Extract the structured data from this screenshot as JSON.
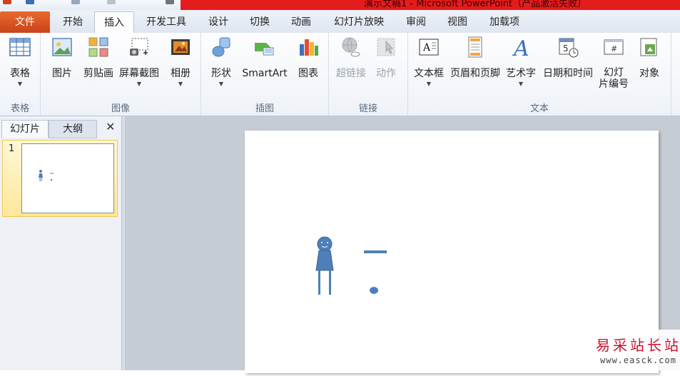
{
  "window": {
    "title": "演示文稿1 - Microsoft PowerPoint（产品激活失败）"
  },
  "tabs": {
    "file": "文件",
    "items": [
      {
        "label": "开始"
      },
      {
        "label": "插入"
      },
      {
        "label": "开发工具"
      },
      {
        "label": "设计"
      },
      {
        "label": "切换"
      },
      {
        "label": "动画"
      },
      {
        "label": "幻灯片放映"
      },
      {
        "label": "审阅"
      },
      {
        "label": "视图"
      },
      {
        "label": "加载项"
      }
    ],
    "active": "插入"
  },
  "ribbon": {
    "groups": {
      "tables": {
        "label": "表格",
        "buttons": {
          "table": "表格"
        }
      },
      "images": {
        "label": "图像",
        "buttons": {
          "picture": "图片",
          "clipart": "剪贴画",
          "screenshot": "屏幕截图",
          "album": "相册"
        }
      },
      "illustrations": {
        "label": "插图",
        "buttons": {
          "shapes": "形状",
          "smartart": "SmartArt",
          "chart": "图表"
        }
      },
      "links": {
        "label": "链接",
        "buttons": {
          "hyperlink": "超链接",
          "action": "动作"
        }
      },
      "text": {
        "label": "文本",
        "buttons": {
          "textbox": "文本框",
          "headerfooter": "页眉和页脚",
          "wordart": "艺术字",
          "datetime": "日期和时间",
          "slidenumber_line1": "幻灯",
          "slidenumber_line2": "片编号",
          "object": "对象"
        }
      }
    }
  },
  "leftpanel": {
    "tabs": {
      "slides": "幻灯片",
      "outline": "大纲"
    },
    "close": "✕",
    "slides": [
      {
        "number": "1"
      }
    ]
  },
  "watermark": {
    "name": "易采站长站",
    "url": "www.easck.com"
  },
  "colors": {
    "accent_red": "#e51c1c",
    "file_tab": "#d0501f",
    "shape_blue": "#4f7fb8"
  }
}
